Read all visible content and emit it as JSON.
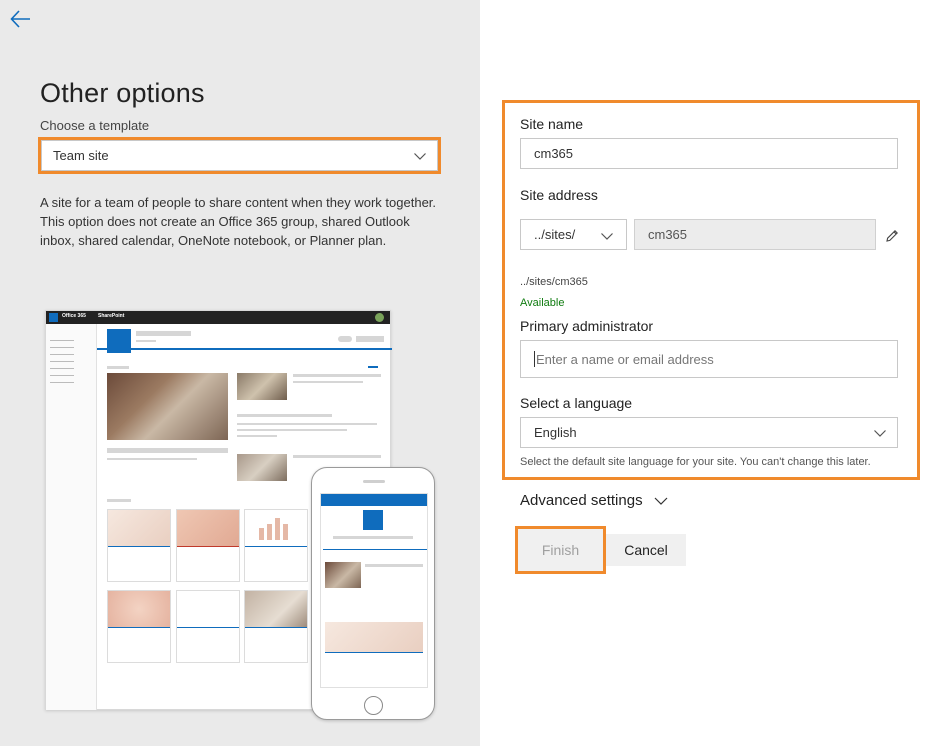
{
  "nav": {
    "back_icon": "arrow-left-icon"
  },
  "page": {
    "title": "Other options",
    "template_label": "Choose a template",
    "template_value": "Team site",
    "description": "A site for a team of people to share content when they work together. This option does not create an Office 365 group, shared Outlook inbox, shared calendar, OneNote notebook, or Planner plan."
  },
  "preview": {
    "suite_app": "Office 365",
    "suite_product": "SharePoint"
  },
  "form": {
    "site_name_label": "Site name",
    "site_name_value": "cm365",
    "site_address_label": "Site address",
    "address_prefix": "../sites/",
    "address_value": "cm365",
    "address_preview": "../sites/cm365",
    "availability": "Available",
    "admin_label": "Primary administrator",
    "admin_placeholder": "Enter a name or email address",
    "language_label": "Select a language",
    "language_value": "English",
    "language_hint": "Select the default site language for your site. You can't change this later."
  },
  "advanced": {
    "label": "Advanced settings"
  },
  "actions": {
    "finish": "Finish",
    "cancel": "Cancel"
  },
  "colors": {
    "accent": "#0f6cbd",
    "highlight": "#f08a2c",
    "available": "#107c10"
  }
}
